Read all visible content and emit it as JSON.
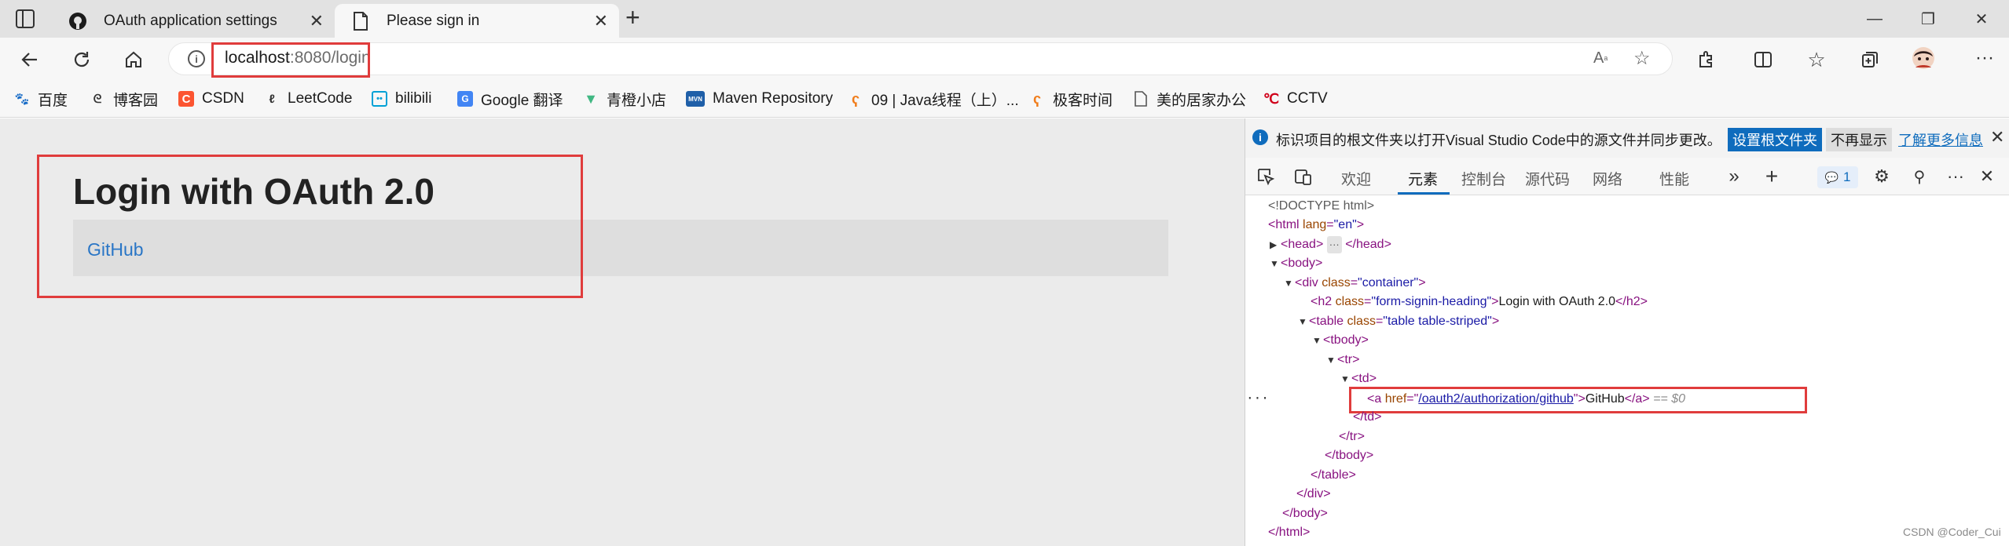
{
  "tabs": [
    {
      "title": "OAuth application settings",
      "icon": "github-icon",
      "close": "✕"
    },
    {
      "title": "Please sign in",
      "icon": "page-icon",
      "close": "✕"
    }
  ],
  "new_tab": "+",
  "window": {
    "minimize": "—",
    "restore": "❐",
    "close": "✕"
  },
  "address": {
    "host": "localhost",
    "path": ":8080/login"
  },
  "bookmarks": [
    {
      "label": "百度",
      "icon": "baidu-icon",
      "color": "#2932e1"
    },
    {
      "label": "博客园",
      "icon": "cnblogs-icon",
      "color": "#333333"
    },
    {
      "label": "CSDN",
      "icon": "csdn-icon",
      "color": "#fc5531"
    },
    {
      "label": "LeetCode",
      "icon": "leetcode-icon",
      "color": "#333333"
    },
    {
      "label": "bilibili",
      "icon": "bilibili-icon",
      "color": "#00a1d6"
    },
    {
      "label": "Google 翻译",
      "icon": "google-translate-icon",
      "color": "#4285f4"
    },
    {
      "label": "青橙小店",
      "icon": "vue-icon",
      "color": "#41b883"
    },
    {
      "label": "Maven Repository",
      "icon": "maven-icon",
      "color": "#1f5fa8"
    },
    {
      "label": "09 | Java线程（上）...",
      "icon": "geektime-icon",
      "color": "#f07c1a"
    },
    {
      "label": "极客时间",
      "icon": "geektime-icon",
      "color": "#f07c1a"
    },
    {
      "label": "美的居家办公",
      "icon": "document-icon",
      "color": "#555555"
    },
    {
      "label": "CCTV",
      "icon": "cctv-icon",
      "color": "#d0021b"
    }
  ],
  "page": {
    "title": "Login with OAuth 2.0",
    "link": "GitHub"
  },
  "devtools": {
    "info": "标识项目的根文件夹以打开Visual Studio Code中的源文件并同步更改。",
    "set_root": "设置根文件夹",
    "dont_show": "不再显示",
    "learn_more": "了解更多信息",
    "tabs": [
      "欢迎",
      "元素",
      "控制台",
      "源代码",
      "网络",
      "性能"
    ],
    "more_tabs": "»",
    "add_tab": "+",
    "issues_count": "1",
    "dom": {
      "doctype": "<!DOCTYPE html>",
      "html_open": "<html",
      "lang_attr": " lang",
      "lang_val": "\"en\"",
      "gt": ">",
      "head": "<head>",
      "head_ell": "···",
      "head_close": "</head>",
      "body_open": "<body>",
      "div_open": "<div",
      "class_attr": " class",
      "container_val": "\"container\"",
      "h2_open": "<h2",
      "h2_class_val": "\"form-signin-heading\"",
      "h2_text": "Login with OAuth 2.0",
      "h2_close": "</h2>",
      "table_open": "<table",
      "table_class_val": "\"table table-striped\"",
      "tbody_open": "<tbody>",
      "tr_open": "<tr>",
      "td_open": "<td>",
      "a_open": "<a",
      "href_attr": " href",
      "href_eq": "=\"",
      "href_val": "/oauth2/authorization/github",
      "href_end": "\">",
      "a_text": "GitHub",
      "a_close": "</a>",
      "eq0": " == $0",
      "td_close": "</td>",
      "tr_close": "</tr>",
      "tbody_close": "</tbody>",
      "table_close": "</table>",
      "div_close": "</div>",
      "body_close": "</body>",
      "html_close": "</html>",
      "left_dots": "···"
    }
  },
  "watermark": "CSDN @Coder_Cui"
}
